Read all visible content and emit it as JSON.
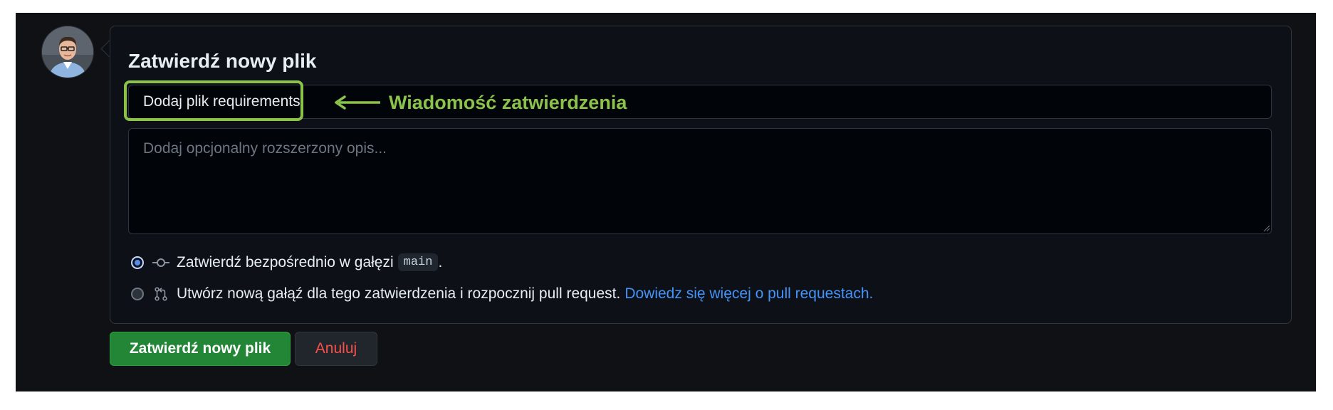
{
  "commit_form": {
    "title": "Zatwierdź nowy plik",
    "summary_value": "Dodaj plik requirements",
    "description_placeholder": "Dodaj opcjonalny rozszerzony opis...",
    "annotation_label": "Wiadomość zatwierdzenia",
    "option_direct": {
      "label": "Zatwierdź bezpośrednio w gałęzi",
      "branch": "main",
      "suffix": "."
    },
    "option_new_branch": {
      "label": "Utwórz nową gałąź dla tego zatwierdzenia i rozpocznij pull request.",
      "link": "Dowiedz się więcej o pull requestach",
      "suffix": "."
    },
    "submit_label": "Zatwierdź nowy plik",
    "cancel_label": "Anuluj"
  },
  "colors": {
    "annotation": "#8bc34a",
    "primary_button": "#238636",
    "link": "#4493f8",
    "cancel_text": "#f85149"
  },
  "icons": [
    "avatar",
    "git-commit-icon",
    "git-pull-request-icon",
    "arrow-left-icon",
    "resize-grip-icon"
  ]
}
